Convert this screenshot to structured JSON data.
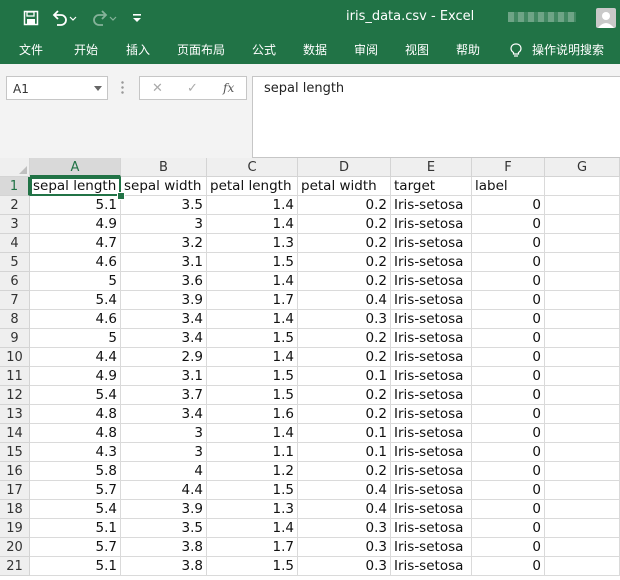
{
  "app": {
    "title": "iris_data.csv  -  Excel"
  },
  "colors": {
    "brand": "#217346",
    "header_bg": "#efefef",
    "selection": "#217346"
  },
  "qat": {
    "save_icon": "save-icon",
    "undo_icon": "undo-icon",
    "redo_icon": "redo-icon",
    "customize_icon": "customize-icon"
  },
  "ribbon": {
    "tabs": [
      "文件",
      "开始",
      "插入",
      "页面布局",
      "公式",
      "数据",
      "审阅",
      "视图",
      "帮助"
    ],
    "tellme": "操作说明搜索"
  },
  "formula": {
    "namebox": "A1",
    "cancel": "✕",
    "enter": "✓",
    "fx": "fx",
    "content": "sepal length"
  },
  "sheet": {
    "columns": [
      "A",
      "B",
      "C",
      "D",
      "E",
      "F",
      "G"
    ],
    "selected_cell": "A1",
    "header": [
      "sepal length",
      "sepal width",
      "petal length",
      "petal width",
      "target",
      "label"
    ],
    "rows": [
      [
        "5.1",
        "3.5",
        "1.4",
        "0.2",
        "Iris-setosa",
        "0"
      ],
      [
        "4.9",
        "3",
        "1.4",
        "0.2",
        "Iris-setosa",
        "0"
      ],
      [
        "4.7",
        "3.2",
        "1.3",
        "0.2",
        "Iris-setosa",
        "0"
      ],
      [
        "4.6",
        "3.1",
        "1.5",
        "0.2",
        "Iris-setosa",
        "0"
      ],
      [
        "5",
        "3.6",
        "1.4",
        "0.2",
        "Iris-setosa",
        "0"
      ],
      [
        "5.4",
        "3.9",
        "1.7",
        "0.4",
        "Iris-setosa",
        "0"
      ],
      [
        "4.6",
        "3.4",
        "1.4",
        "0.3",
        "Iris-setosa",
        "0"
      ],
      [
        "5",
        "3.4",
        "1.5",
        "0.2",
        "Iris-setosa",
        "0"
      ],
      [
        "4.4",
        "2.9",
        "1.4",
        "0.2",
        "Iris-setosa",
        "0"
      ],
      [
        "4.9",
        "3.1",
        "1.5",
        "0.1",
        "Iris-setosa",
        "0"
      ],
      [
        "5.4",
        "3.7",
        "1.5",
        "0.2",
        "Iris-setosa",
        "0"
      ],
      [
        "4.8",
        "3.4",
        "1.6",
        "0.2",
        "Iris-setosa",
        "0"
      ],
      [
        "4.8",
        "3",
        "1.4",
        "0.1",
        "Iris-setosa",
        "0"
      ],
      [
        "4.3",
        "3",
        "1.1",
        "0.1",
        "Iris-setosa",
        "0"
      ],
      [
        "5.8",
        "4",
        "1.2",
        "0.2",
        "Iris-setosa",
        "0"
      ],
      [
        "5.7",
        "4.4",
        "1.5",
        "0.4",
        "Iris-setosa",
        "0"
      ],
      [
        "5.4",
        "3.9",
        "1.3",
        "0.4",
        "Iris-setosa",
        "0"
      ],
      [
        "5.1",
        "3.5",
        "1.4",
        "0.3",
        "Iris-setosa",
        "0"
      ],
      [
        "5.7",
        "3.8",
        "1.7",
        "0.3",
        "Iris-setosa",
        "0"
      ],
      [
        "5.1",
        "3.8",
        "1.5",
        "0.3",
        "Iris-setosa",
        "0"
      ]
    ]
  }
}
